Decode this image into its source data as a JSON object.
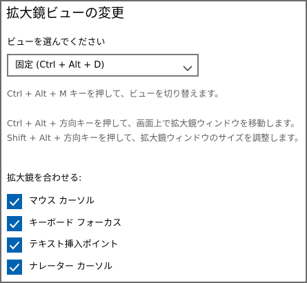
{
  "header": {
    "title": "拡大鏡ビューの変更"
  },
  "view": {
    "label": "ビューを選んでください",
    "selected": "固定 (Ctrl + Alt + D)"
  },
  "hints": {
    "switch_view": "Ctrl + Alt + M キーを押して、ビューを切り替えます。",
    "move_window": "Ctrl + Alt + 方向キーを押して、画面上で拡大鏡ウィンドウを移動します。",
    "resize_window": "Shift + Alt + 方向キーを押して、拡大鏡ウィンドウのサイズを調整します。"
  },
  "follow": {
    "label": "拡大鏡を合わせる:",
    "options": [
      {
        "label": "マウス カーソル",
        "checked": true
      },
      {
        "label": "キーボード フォーカス",
        "checked": true
      },
      {
        "label": "テキスト挿入ポイント",
        "checked": true
      },
      {
        "label": "ナレーター カーソル",
        "checked": true
      }
    ]
  },
  "colors": {
    "accent": "#0063b1",
    "hint_text": "#616161",
    "border": "#7a7a7a"
  },
  "icons": {
    "dropdown": "chevron-down-icon",
    "check": "checkmark-icon"
  }
}
